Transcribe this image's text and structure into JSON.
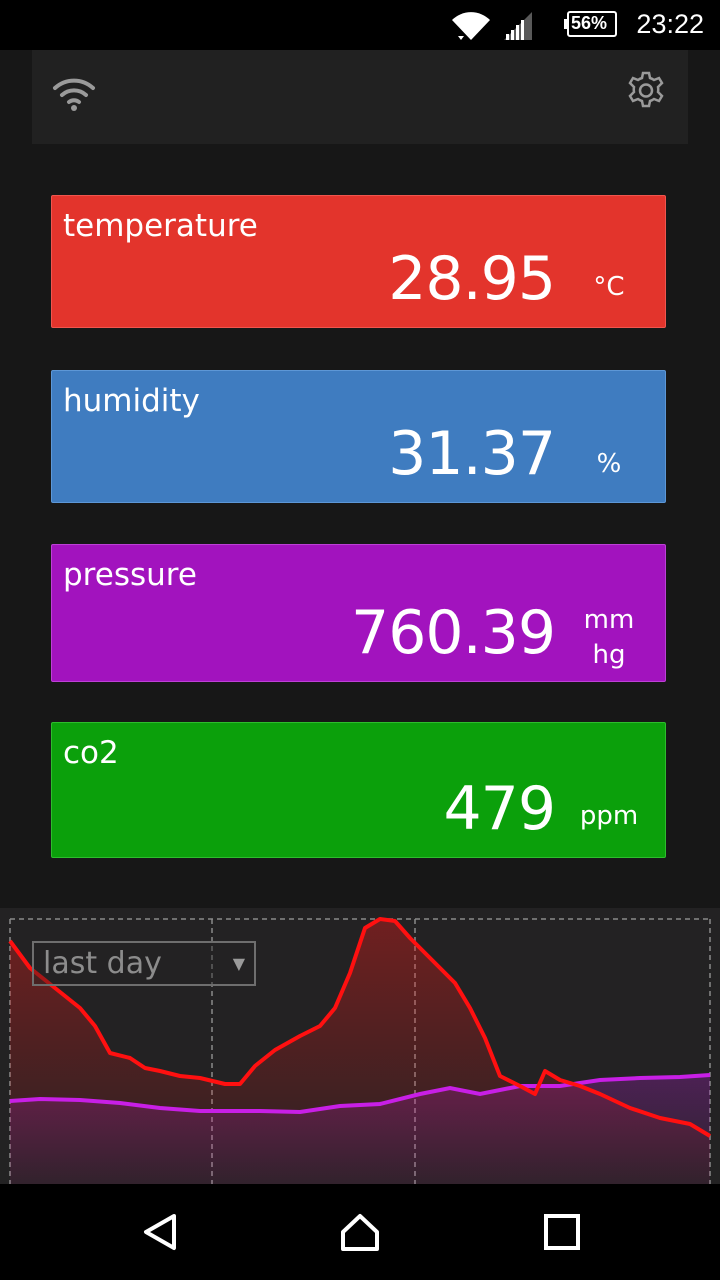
{
  "status_bar": {
    "battery": "56%",
    "time": "23:22",
    "icons": [
      "wifi-icon",
      "signal-icon",
      "battery-icon"
    ]
  },
  "toolbar": {
    "icons": [
      "wifi-icon",
      "gear-icon"
    ]
  },
  "sensors": [
    {
      "label": "temperature",
      "value": "28.95",
      "unit": "°C",
      "color": "#e3342c"
    },
    {
      "label": "humidity",
      "value": "31.37",
      "unit": "%",
      "color": "#3f7cc0"
    },
    {
      "label": "pressure",
      "value": "760.39",
      "unit_line1": "mm",
      "unit_line2": "hg",
      "color": "#a213be"
    },
    {
      "label": "co2",
      "value": "479",
      "unit": "ppm",
      "color": "#0ba00b"
    }
  ],
  "chart": {
    "range_selected": "last day",
    "series_colors": {
      "temperature": "#ff1010",
      "pressure": "#c81fe6"
    }
  },
  "nav_bar": {
    "icons": [
      "back-icon",
      "home-icon",
      "recents-icon"
    ]
  }
}
